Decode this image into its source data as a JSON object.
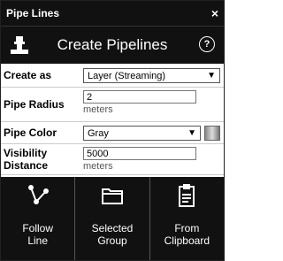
{
  "window": {
    "title": "Pipe Lines",
    "close": "×"
  },
  "header": {
    "title": "Create Pipelines",
    "help": "?"
  },
  "form": {
    "create_as": {
      "label": "Create as",
      "value": "Layer (Streaming)"
    },
    "pipe_radius": {
      "label": "Pipe Radius",
      "value": "2",
      "unit": "meters"
    },
    "pipe_color": {
      "label": "Pipe Color",
      "value": "Gray"
    },
    "visibility_distance": {
      "label_line1": "Visibility",
      "label_line2": "Distance",
      "value": "5000",
      "unit": "meters"
    }
  },
  "toolbar": [
    {
      "line1": "Follow",
      "line2": "Line",
      "icon": "follow-line-icon"
    },
    {
      "line1": "Selected",
      "line2": "Group",
      "icon": "folder-icon"
    },
    {
      "line1": "From",
      "line2": "Clipboard",
      "icon": "clipboard-icon"
    }
  ],
  "colors": {
    "bar": "#111111",
    "text_light": "#ffffff"
  }
}
